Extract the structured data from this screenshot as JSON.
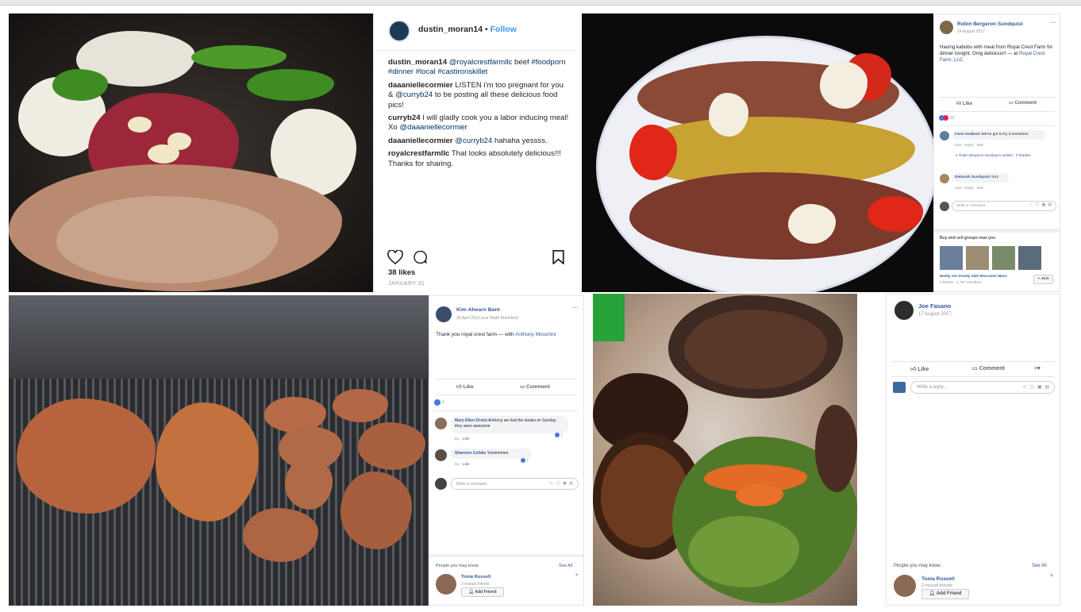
{
  "instagram": {
    "username": "dustin_moran14",
    "separator": "•",
    "follow_label": "Follow",
    "comments": [
      {
        "user": "dustin_moran14",
        "mention": "@royalcrestfarmllc",
        "text": " beef ",
        "tags": "#foodporn #dinner #local #castironskillet"
      },
      {
        "user": "daaaniellecormier",
        "text_a": " LISTEN i'm too pregnant for you & ",
        "mention": "@curryb24",
        "text_b": " to be posting all these delicious food pics!"
      },
      {
        "user": "curryb24",
        "text_a": " I will gladly cook you a labor inducing meal! Xo ",
        "mention": "@daaaniellecormier"
      },
      {
        "user": "daaaniellecormier",
        "mention": "@curryb24",
        "text_a": " hahaha yessss."
      },
      {
        "user": "royalcrestfarmllc",
        "text_a": " That looks absolutely delicious!!! Thanks for sharing."
      }
    ],
    "likes": "38 likes",
    "date": "JANUARY 31"
  },
  "fb_robin": {
    "name": "Robin Bergeron Sundquist",
    "date": "14 August 2017 ·",
    "text": "Having kabobs with meat from Royal Crest Farm for dinner tonight. Omg delicious!! — at ",
    "place": "Royal Crest Farm, LLC",
    "like": "Like",
    "comment": "Comment",
    "reaction_count": "10",
    "comments": [
      {
        "name": "Irene Gedbois",
        "text": " We've got to try it sometime.",
        "actions": "Like · Reply · 38w"
      },
      {
        "name": "Deborah Sundquist",
        "text": " Yum",
        "actions": "Like · Reply · 38w"
      }
    ],
    "reply_line": "Robin Bergeron Sundquist replied · 2 Replies",
    "write_comment": "Write a comment...",
    "groups_title": "Buy and sell groups near you",
    "group_name": "Needy not Greedy Sale Worcester Mass",
    "group_meta": "2 friends · 1,787 members",
    "join_label": "+ Join"
  },
  "fb_kim": {
    "name": "Kim Ahearn Bent",
    "date": "30 April 2013 near North Brookfield ·",
    "text": "Thank you royal crest farm — with ",
    "with_name": "Anthony Moschini",
    "like": "Like",
    "comment": "Comment",
    "reaction_count": "3",
    "comments": [
      {
        "name": "Mary Ellen Orsini",
        "text": " Anthony we had the steaks on Sunday they were awesome",
        "actions": "Like",
        "count": "1"
      },
      {
        "name": "Shannon Cofske",
        "text": " Yummmmm",
        "actions": "Like",
        "count": "1"
      }
    ],
    "write_comment": "Write a comment...",
    "people_title": "People you may know",
    "see_all": "See All",
    "person_name": "Tonia Russell",
    "mutual": "2 mutual friends",
    "add_friend": "Add Friend"
  },
  "fb_joe": {
    "name": "Joe Fasano",
    "date": "17 August 2017",
    "like": "Like",
    "comment": "Comment",
    "write_reply": "Write a reply...",
    "people_title": "People you may know",
    "see_all": "See All",
    "person_name": "Tonia Russell",
    "mutual": "2 mutual friends",
    "add_friend": "Add Friend"
  },
  "colors": {
    "ig_blue": "#3897f0",
    "fb_blue": "#365899",
    "fb_gray": "#90949c"
  }
}
